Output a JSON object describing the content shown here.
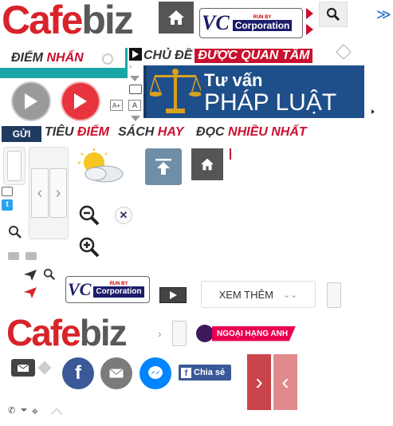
{
  "header": {
    "logo": {
      "part1": "Cafe",
      "part2": "biz"
    },
    "vc_logo": {
      "letters": "VC",
      "run_by": "RUN BY",
      "corp": "Corporation"
    },
    "more_glyph": "≫"
  },
  "sections": {
    "diem_nhan": {
      "w1": "ĐIỂM",
      "w2": "NHẤN"
    },
    "chu_de": {
      "w1": "CHỦ ĐỀ",
      "w2": "ĐƯỢC QUAN TÂM"
    },
    "tu_van": {
      "line1": "Tư vấn",
      "line2": "PHÁP LUẬT"
    },
    "gui": "GỬI",
    "tieu_diem": {
      "w1": "TIÊU",
      "w2": "ĐIỂM"
    },
    "sach_hay": {
      "w1": "SÁCH",
      "w2": "HAY"
    },
    "doc_nhieu": {
      "w1": "ĐỌC",
      "w2": "NHIỀU NHẤT"
    }
  },
  "controls": {
    "xem_them": "XEM THÊM",
    "premier_league": "NGOẠI HẠNG ANH",
    "share_label": "Chia sẻ",
    "zoom_labels": {
      "a_plus": "A+",
      "a": "A"
    }
  },
  "colors": {
    "brand_red": "#c8102e",
    "teal": "#1aa6a6",
    "navy": "#1f4f8a",
    "facebook": "#3b5998",
    "messenger": "#0084ff"
  }
}
